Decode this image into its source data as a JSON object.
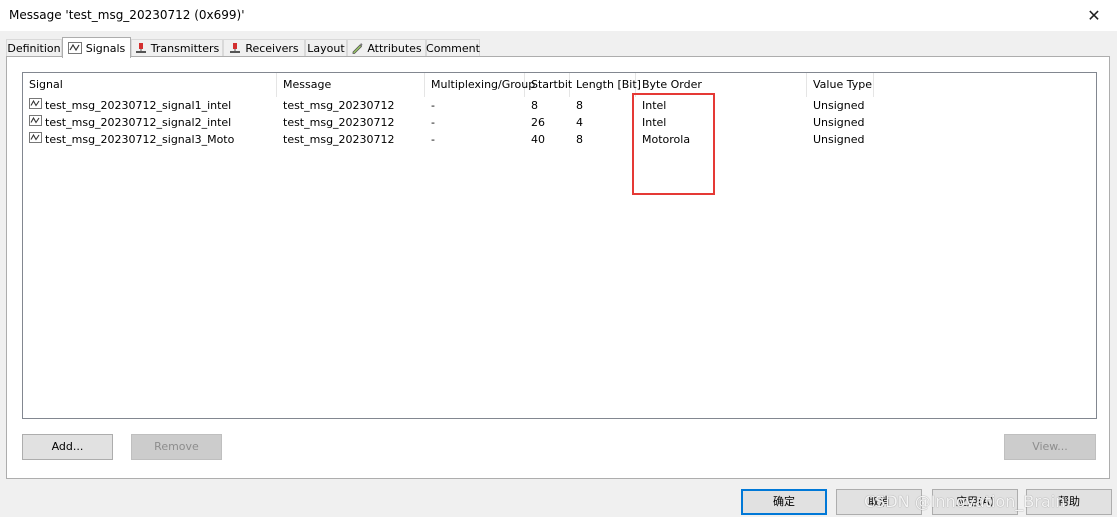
{
  "window": {
    "title": "Message 'test_msg_20230712 (0x699)'",
    "close_label": "✕"
  },
  "tabs": [
    {
      "label": "Definition",
      "icon": "none"
    },
    {
      "label": "Signals",
      "icon": "signal-icon"
    },
    {
      "label": "Transmitters",
      "icon": "transmitter-icon"
    },
    {
      "label": "Receivers",
      "icon": "receiver-icon"
    },
    {
      "label": "Layout",
      "icon": "none"
    },
    {
      "label": "Attributes",
      "icon": "attributes-icon"
    },
    {
      "label": "Comment",
      "icon": "none"
    }
  ],
  "active_tab": "Signals",
  "table": {
    "columns": [
      "Signal",
      "Message",
      "Multiplexing/Group",
      "Startbit",
      "Length [Bit]",
      "Byte Order",
      "Value Type"
    ],
    "rows": [
      {
        "signal": "test_msg_20230712_signal1_intel",
        "message": "test_msg_20230712",
        "mux": "-",
        "startbit": "8",
        "length": "8",
        "byte_order": "Intel",
        "value_type": "Unsigned"
      },
      {
        "signal": "test_msg_20230712_signal2_intel",
        "message": "test_msg_20230712",
        "mux": "-",
        "startbit": "26",
        "length": "4",
        "byte_order": "Intel",
        "value_type": "Unsigned"
      },
      {
        "signal": "test_msg_20230712_signal3_Moto",
        "message": "test_msg_20230712",
        "mux": "-",
        "startbit": "40",
        "length": "8",
        "byte_order": "Motorola",
        "value_type": "Unsigned"
      }
    ]
  },
  "panel_buttons": {
    "add": "Add...",
    "remove": "Remove",
    "view": "View..."
  },
  "dialog_buttons": {
    "ok": "确定",
    "cancel": "取消",
    "apply": "应用(A)",
    "help": "帮助"
  },
  "watermark": "CSDN @Innovation_Brain",
  "colors": {
    "highlight": "#e53935",
    "accent": "#0078d7"
  }
}
